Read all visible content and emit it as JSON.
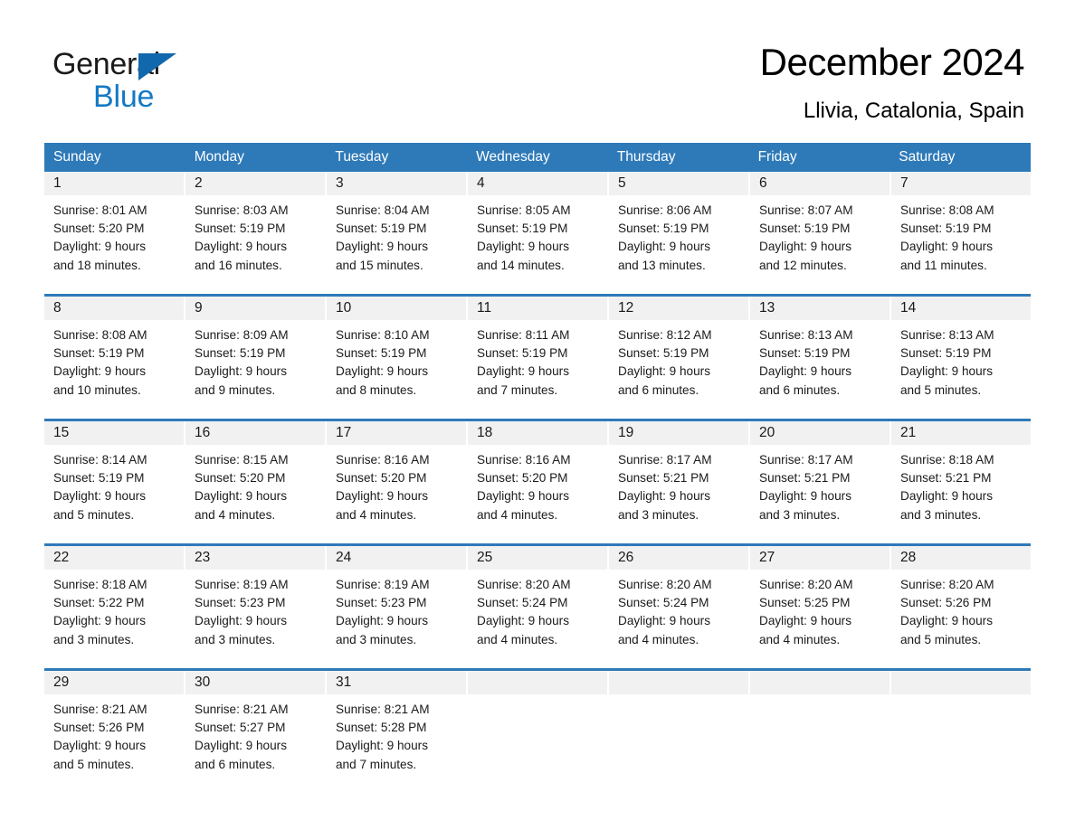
{
  "brand": {
    "name_top": "General",
    "name_bottom": "Blue",
    "accent_color": "#1479c4",
    "triangle_color": "#1168ad"
  },
  "header": {
    "title": "December 2024",
    "subtitle": "Llivia, Catalonia, Spain"
  },
  "calendar": {
    "header_bg": "#2e7ab8",
    "header_text_color": "#ffffff",
    "daynum_band_bg": "#f1f1f1",
    "weekdays": [
      "Sunday",
      "Monday",
      "Tuesday",
      "Wednesday",
      "Thursday",
      "Friday",
      "Saturday"
    ],
    "weeks": [
      [
        {
          "day": "1",
          "sunrise": "Sunrise: 8:01 AM",
          "sunset": "Sunset: 5:20 PM",
          "daylight1": "Daylight: 9 hours",
          "daylight2": "and 18 minutes."
        },
        {
          "day": "2",
          "sunrise": "Sunrise: 8:03 AM",
          "sunset": "Sunset: 5:19 PM",
          "daylight1": "Daylight: 9 hours",
          "daylight2": "and 16 minutes."
        },
        {
          "day": "3",
          "sunrise": "Sunrise: 8:04 AM",
          "sunset": "Sunset: 5:19 PM",
          "daylight1": "Daylight: 9 hours",
          "daylight2": "and 15 minutes."
        },
        {
          "day": "4",
          "sunrise": "Sunrise: 8:05 AM",
          "sunset": "Sunset: 5:19 PM",
          "daylight1": "Daylight: 9 hours",
          "daylight2": "and 14 minutes."
        },
        {
          "day": "5",
          "sunrise": "Sunrise: 8:06 AM",
          "sunset": "Sunset: 5:19 PM",
          "daylight1": "Daylight: 9 hours",
          "daylight2": "and 13 minutes."
        },
        {
          "day": "6",
          "sunrise": "Sunrise: 8:07 AM",
          "sunset": "Sunset: 5:19 PM",
          "daylight1": "Daylight: 9 hours",
          "daylight2": "and 12 minutes."
        },
        {
          "day": "7",
          "sunrise": "Sunrise: 8:08 AM",
          "sunset": "Sunset: 5:19 PM",
          "daylight1": "Daylight: 9 hours",
          "daylight2": "and 11 minutes."
        }
      ],
      [
        {
          "day": "8",
          "sunrise": "Sunrise: 8:08 AM",
          "sunset": "Sunset: 5:19 PM",
          "daylight1": "Daylight: 9 hours",
          "daylight2": "and 10 minutes."
        },
        {
          "day": "9",
          "sunrise": "Sunrise: 8:09 AM",
          "sunset": "Sunset: 5:19 PM",
          "daylight1": "Daylight: 9 hours",
          "daylight2": "and 9 minutes."
        },
        {
          "day": "10",
          "sunrise": "Sunrise: 8:10 AM",
          "sunset": "Sunset: 5:19 PM",
          "daylight1": "Daylight: 9 hours",
          "daylight2": "and 8 minutes."
        },
        {
          "day": "11",
          "sunrise": "Sunrise: 8:11 AM",
          "sunset": "Sunset: 5:19 PM",
          "daylight1": "Daylight: 9 hours",
          "daylight2": "and 7 minutes."
        },
        {
          "day": "12",
          "sunrise": "Sunrise: 8:12 AM",
          "sunset": "Sunset: 5:19 PM",
          "daylight1": "Daylight: 9 hours",
          "daylight2": "and 6 minutes."
        },
        {
          "day": "13",
          "sunrise": "Sunrise: 8:13 AM",
          "sunset": "Sunset: 5:19 PM",
          "daylight1": "Daylight: 9 hours",
          "daylight2": "and 6 minutes."
        },
        {
          "day": "14",
          "sunrise": "Sunrise: 8:13 AM",
          "sunset": "Sunset: 5:19 PM",
          "daylight1": "Daylight: 9 hours",
          "daylight2": "and 5 minutes."
        }
      ],
      [
        {
          "day": "15",
          "sunrise": "Sunrise: 8:14 AM",
          "sunset": "Sunset: 5:19 PM",
          "daylight1": "Daylight: 9 hours",
          "daylight2": "and 5 minutes."
        },
        {
          "day": "16",
          "sunrise": "Sunrise: 8:15 AM",
          "sunset": "Sunset: 5:20 PM",
          "daylight1": "Daylight: 9 hours",
          "daylight2": "and 4 minutes."
        },
        {
          "day": "17",
          "sunrise": "Sunrise: 8:16 AM",
          "sunset": "Sunset: 5:20 PM",
          "daylight1": "Daylight: 9 hours",
          "daylight2": "and 4 minutes."
        },
        {
          "day": "18",
          "sunrise": "Sunrise: 8:16 AM",
          "sunset": "Sunset: 5:20 PM",
          "daylight1": "Daylight: 9 hours",
          "daylight2": "and 4 minutes."
        },
        {
          "day": "19",
          "sunrise": "Sunrise: 8:17 AM",
          "sunset": "Sunset: 5:21 PM",
          "daylight1": "Daylight: 9 hours",
          "daylight2": "and 3 minutes."
        },
        {
          "day": "20",
          "sunrise": "Sunrise: 8:17 AM",
          "sunset": "Sunset: 5:21 PM",
          "daylight1": "Daylight: 9 hours",
          "daylight2": "and 3 minutes."
        },
        {
          "day": "21",
          "sunrise": "Sunrise: 8:18 AM",
          "sunset": "Sunset: 5:21 PM",
          "daylight1": "Daylight: 9 hours",
          "daylight2": "and 3 minutes."
        }
      ],
      [
        {
          "day": "22",
          "sunrise": "Sunrise: 8:18 AM",
          "sunset": "Sunset: 5:22 PM",
          "daylight1": "Daylight: 9 hours",
          "daylight2": "and 3 minutes."
        },
        {
          "day": "23",
          "sunrise": "Sunrise: 8:19 AM",
          "sunset": "Sunset: 5:23 PM",
          "daylight1": "Daylight: 9 hours",
          "daylight2": "and 3 minutes."
        },
        {
          "day": "24",
          "sunrise": "Sunrise: 8:19 AM",
          "sunset": "Sunset: 5:23 PM",
          "daylight1": "Daylight: 9 hours",
          "daylight2": "and 3 minutes."
        },
        {
          "day": "25",
          "sunrise": "Sunrise: 8:20 AM",
          "sunset": "Sunset: 5:24 PM",
          "daylight1": "Daylight: 9 hours",
          "daylight2": "and 4 minutes."
        },
        {
          "day": "26",
          "sunrise": "Sunrise: 8:20 AM",
          "sunset": "Sunset: 5:24 PM",
          "daylight1": "Daylight: 9 hours",
          "daylight2": "and 4 minutes."
        },
        {
          "day": "27",
          "sunrise": "Sunrise: 8:20 AM",
          "sunset": "Sunset: 5:25 PM",
          "daylight1": "Daylight: 9 hours",
          "daylight2": "and 4 minutes."
        },
        {
          "day": "28",
          "sunrise": "Sunrise: 8:20 AM",
          "sunset": "Sunset: 5:26 PM",
          "daylight1": "Daylight: 9 hours",
          "daylight2": "and 5 minutes."
        }
      ],
      [
        {
          "day": "29",
          "sunrise": "Sunrise: 8:21 AM",
          "sunset": "Sunset: 5:26 PM",
          "daylight1": "Daylight: 9 hours",
          "daylight2": "and 5 minutes."
        },
        {
          "day": "30",
          "sunrise": "Sunrise: 8:21 AM",
          "sunset": "Sunset: 5:27 PM",
          "daylight1": "Daylight: 9 hours",
          "daylight2": "and 6 minutes."
        },
        {
          "day": "31",
          "sunrise": "Sunrise: 8:21 AM",
          "sunset": "Sunset: 5:28 PM",
          "daylight1": "Daylight: 9 hours",
          "daylight2": "and 7 minutes."
        },
        {
          "day": "",
          "sunrise": "",
          "sunset": "",
          "daylight1": "",
          "daylight2": ""
        },
        {
          "day": "",
          "sunrise": "",
          "sunset": "",
          "daylight1": "",
          "daylight2": ""
        },
        {
          "day": "",
          "sunrise": "",
          "sunset": "",
          "daylight1": "",
          "daylight2": ""
        },
        {
          "day": "",
          "sunrise": "",
          "sunset": "",
          "daylight1": "",
          "daylight2": ""
        }
      ]
    ]
  }
}
